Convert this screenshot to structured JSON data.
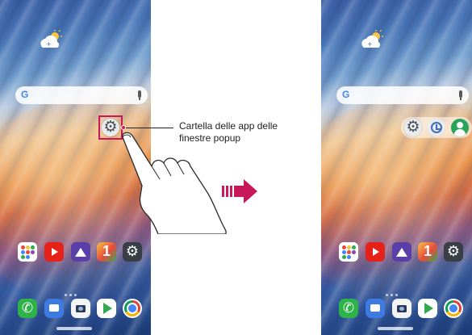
{
  "callout": {
    "text": "Cartella delle app delle finestre popup"
  },
  "search": {
    "logo": "G"
  },
  "screens": [
    {
      "id": "before",
      "home_icons": [
        "gear-icon"
      ]
    },
    {
      "id": "after",
      "popup_folder_apps": [
        "gear-icon",
        "clock-icon",
        "contacts-icon"
      ]
    }
  ],
  "dock": {
    "row1": [
      "apps-grid-icon",
      "youtube-icon",
      "gallery-icon",
      "one-icon",
      "settings-icon"
    ],
    "row2": [
      "phone-icon",
      "messages-icon",
      "camera-icon",
      "play-store-icon",
      "chrome-icon"
    ]
  },
  "colors": {
    "highlight": "#c8185a",
    "arrow": "#c8185a"
  }
}
